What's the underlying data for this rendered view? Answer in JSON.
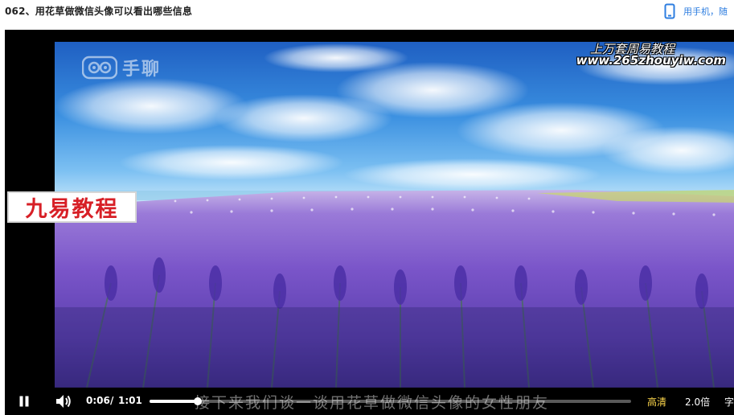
{
  "page": {
    "title": "062、用花草做微信头像可以看出哪些信息",
    "mobile_link": "用手机，随"
  },
  "video": {
    "app_watermark": "手聊",
    "site_title": "上万套周易教程",
    "site_url": "www.265zhouyiw.com",
    "brand_badge": "九易教程",
    "subtitle": "接下来我们谈一谈用花草做微信头像的女性朋友"
  },
  "controls": {
    "current_time": "0:06",
    "separator": "/",
    "total_time": "1:01",
    "progress_fraction": 0.1,
    "quality_label": "高清",
    "speed_label": "2.0倍",
    "subtitle_toggle_label": "字"
  },
  "icons": {
    "phone": "phone-icon",
    "pause": "pause-icon",
    "volume": "volume-icon",
    "app_logo": "owl-logo-icon"
  },
  "colors": {
    "link": "#2e7ee0",
    "badge_text": "#d71f26",
    "quality_active": "#ffd84c"
  }
}
